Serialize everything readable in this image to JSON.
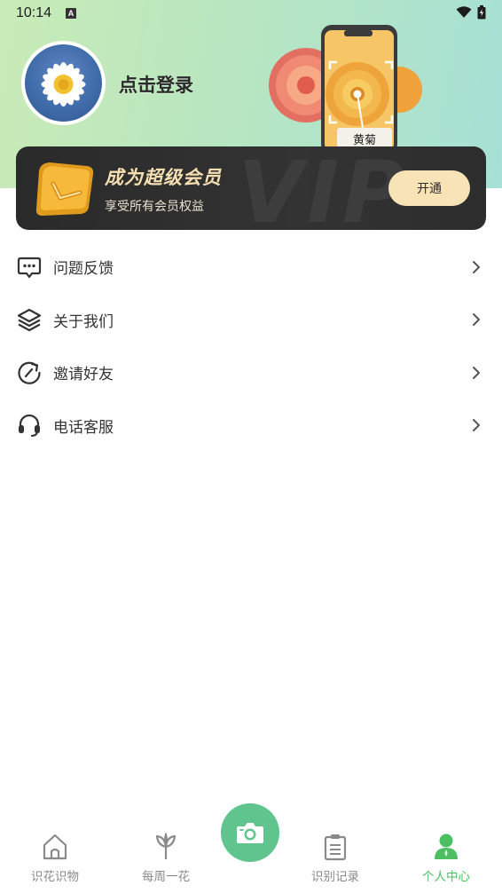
{
  "status_bar": {
    "time": "10:14",
    "indicator": "A"
  },
  "profile": {
    "login_text": "点击登录"
  },
  "promo_art": {
    "flower_label": "黄菊"
  },
  "vip": {
    "watermark": "VIP",
    "title": "成为超级会员",
    "subtitle": "享受所有会员权益",
    "button_label": "开通"
  },
  "menu": [
    {
      "label": "问题反馈",
      "icon": "feedback-icon"
    },
    {
      "label": "关于我们",
      "icon": "layers-icon"
    },
    {
      "label": "邀请好友",
      "icon": "share-refresh-icon"
    },
    {
      "label": "电话客服",
      "icon": "headset-icon"
    }
  ],
  "tabbar": {
    "tabs": [
      {
        "label": "识花识物",
        "icon": "home-icon",
        "active": false
      },
      {
        "label": "每周一花",
        "icon": "sprout-icon",
        "active": false
      },
      {
        "label": "识别记录",
        "icon": "clipboard-icon",
        "active": false
      },
      {
        "label": "个人中心",
        "icon": "person-icon",
        "active": true
      }
    ],
    "center_icon": "camera-icon"
  },
  "colors": {
    "accent_green": "#4cbf62",
    "camera_green": "#5fc48d",
    "vip_gold": "#f6dfb0",
    "vip_button": "#f8e3b6",
    "vip_card": "#2a2a2a"
  }
}
